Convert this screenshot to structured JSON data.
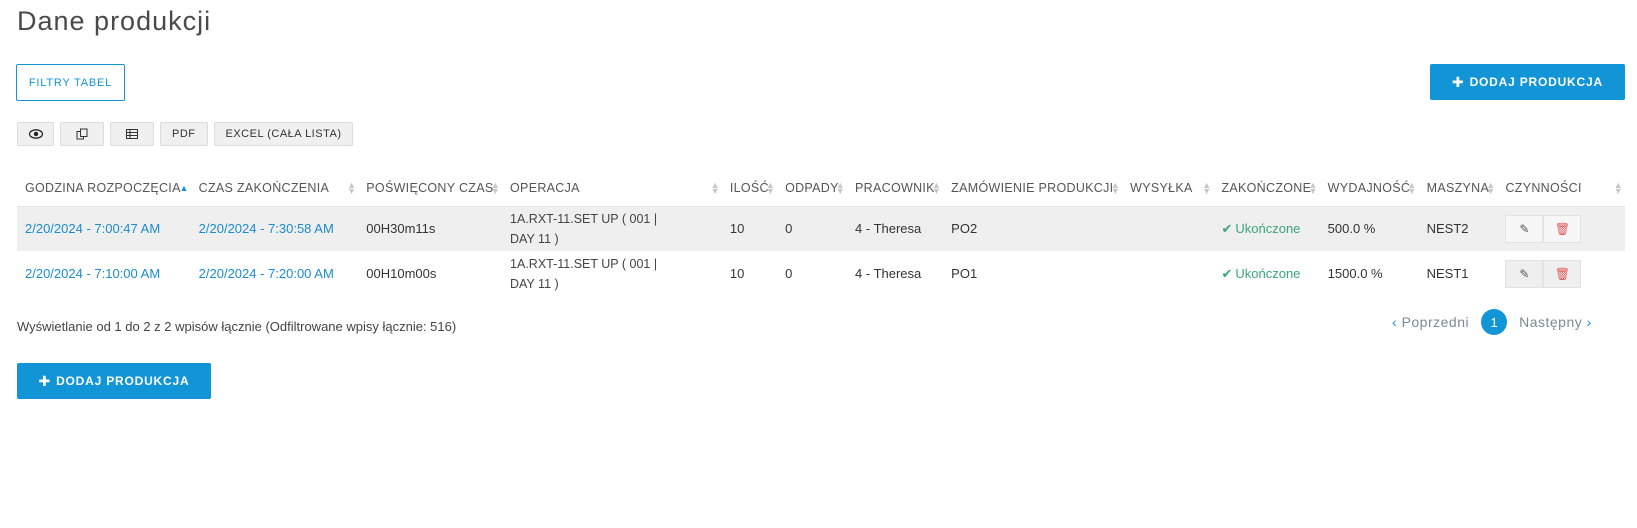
{
  "page": {
    "title": "Dane produkcji"
  },
  "toolbar": {
    "filters_label": "FILTRY TABEL",
    "add_label": "DODAJ PRODUKCJA",
    "add_icon": "plus-icon"
  },
  "export": {
    "view_icon": "eye-icon",
    "copy_icon": "copy-icon",
    "csv_icon": "table-icon",
    "pdf_label": "PDF",
    "excel_label": "EXCEL (CAŁA LISTA)"
  },
  "table": {
    "columns": [
      "GODZINA ROZPOCZĘCIA",
      "CZAS ZAKOŃCZENIA",
      "POŚWIĘCONY CZAS",
      "OPERACJA",
      "ILOŚĆ",
      "ODPADY",
      "PRACOWNIK",
      "ZAMÓWIENIE PRODUKCJI",
      "WYSYŁKA",
      "ZAKOŃCZONE",
      "WYDAJNOŚĆ",
      "MASZYNA",
      "CZYNNOŚCI"
    ],
    "sorted_column": "GODZINA ROZPOCZĘCIA",
    "sort_direction": "asc",
    "rows": [
      {
        "start": "2/20/2024 - 7:00:47 AM",
        "end": "2/20/2024 - 7:30:58 AM",
        "spent": "00H30m11s",
        "operation_line1": "1A.RXT-11.SET UP ( 001 |",
        "operation_line2": "DAY 11 )",
        "qty": "10",
        "waste": "0",
        "worker": "4 - Theresa",
        "order": "PO2",
        "shipping": "",
        "finished": "Ukończone",
        "efficiency": "500.0 %",
        "machine": "NEST2"
      },
      {
        "start": "2/20/2024 - 7:10:00 AM",
        "end": "2/20/2024 - 7:20:00 AM",
        "spent": "00H10m00s",
        "operation_line1": "1A.RXT-11.SET UP ( 001 |",
        "operation_line2": "DAY 11 )",
        "qty": "10",
        "waste": "0",
        "worker": "4 - Theresa",
        "order": "PO1",
        "shipping": "",
        "finished": "Ukończone",
        "efficiency": "1500.0 %",
        "machine": "NEST1"
      }
    ]
  },
  "footer": {
    "info": "Wyświetlanie od 1 do 2 z 2 wpisów łącznie (Odfiltrowane wpisy łącznie: 516)",
    "prev_label": "Poprzedni",
    "next_label": "Następny",
    "current_page": "1"
  },
  "colors": {
    "accent": "#1195d6",
    "success": "#3aa57a",
    "danger": "#e05858"
  }
}
